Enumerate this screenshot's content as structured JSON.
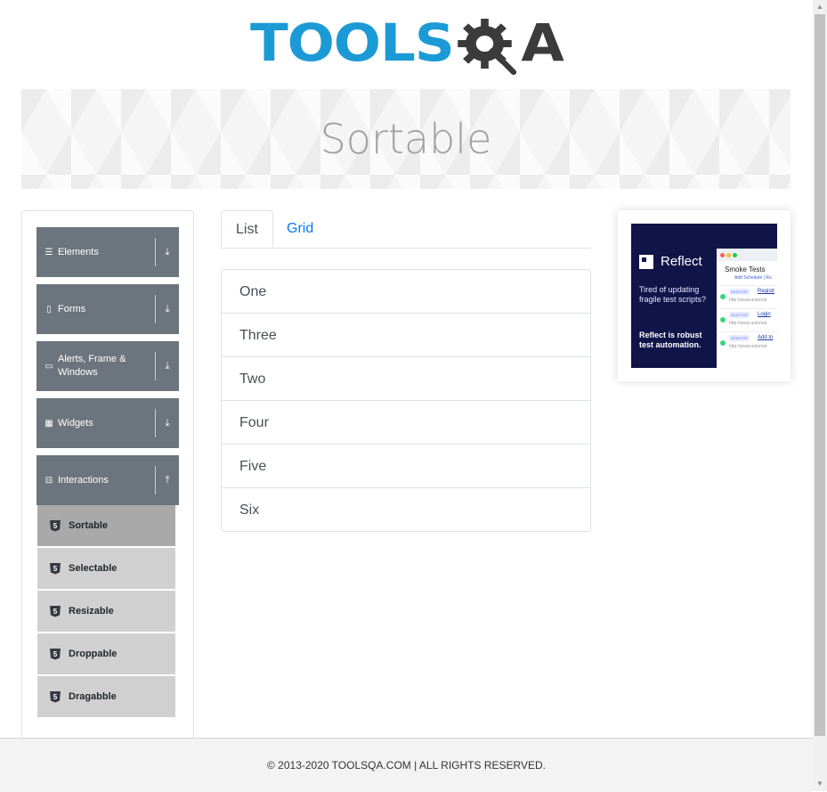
{
  "header": {
    "logo_part1": "TOOLS",
    "logo_part2": "A"
  },
  "banner": {
    "title": "Sortable"
  },
  "sidebar": {
    "groups": [
      {
        "label": "Elements",
        "icon": "hamburger-icon",
        "expanded": false
      },
      {
        "label": "Forms",
        "icon": "document-icon",
        "expanded": false
      },
      {
        "label": "Alerts, Frame & Windows",
        "icon": "window-icon",
        "expanded": false
      },
      {
        "label": "Widgets",
        "icon": "grid-icon",
        "expanded": false
      },
      {
        "label": "Interactions",
        "icon": "collapse-icon",
        "expanded": true
      }
    ],
    "sub_items": [
      {
        "label": "Sortable",
        "active": true
      },
      {
        "label": "Selectable",
        "active": false
      },
      {
        "label": "Resizable",
        "active": false
      },
      {
        "label": "Droppable",
        "active": false
      },
      {
        "label": "Dragabble",
        "active": false
      }
    ]
  },
  "tabs": [
    {
      "label": "List",
      "active": true
    },
    {
      "label": "Grid",
      "active": false
    }
  ],
  "list_items": [
    "One",
    "Three",
    "Two",
    "Four",
    "Five",
    "Six"
  ],
  "ad": {
    "brand": "Reflect",
    "tagline": "Tired of updating fragile test scripts?",
    "cta": "Reflect is robust test automation.",
    "panel_title": "Smoke Tests",
    "panel_link": "Add Schedule | Ru",
    "rows": [
      {
        "badge": "DESKTOP",
        "name": "Registr",
        "url": "http://www.automat"
      },
      {
        "badge": "DESKTOP",
        "name": "Login",
        "url": "http://www.automat"
      },
      {
        "badge": "DESKTOP",
        "name": "Add to",
        "url": "http://www.automat"
      }
    ]
  },
  "footer": {
    "text": "© 2013-2020 TOOLSQA.COM | ALL RIGHTS RESERVED."
  },
  "colors": {
    "group_bg": "#6c757d",
    "sub_bg": "#d0d0d0",
    "sub_active_bg": "#a9a9a9",
    "tab_link": "#007bff",
    "logo_blue": "#1c9ad6",
    "logo_dark": "#3b3b3b",
    "ad_bg": "#101449"
  }
}
